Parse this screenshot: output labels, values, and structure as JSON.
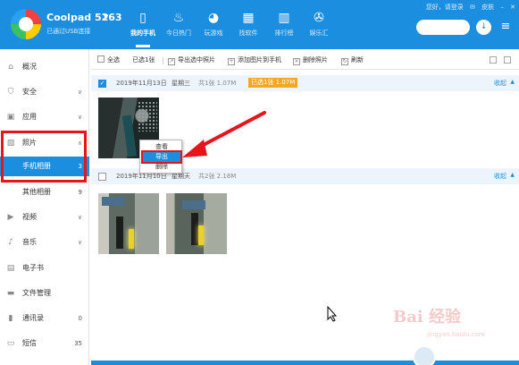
{
  "header": {
    "device_name": "Coolpad 5263",
    "device_status": "已通过USB连接",
    "nav_tabs": [
      {
        "label": "我的手机",
        "icon": "phone-icon",
        "active": true
      },
      {
        "label": "今日热门",
        "icon": "flame-icon",
        "active": false
      },
      {
        "label": "玩游戏",
        "icon": "gamepad-icon",
        "active": false
      },
      {
        "label": "找软件",
        "icon": "grid-icon",
        "active": false
      },
      {
        "label": "排行榜",
        "icon": "bar-chart-icon",
        "active": false
      },
      {
        "label": "娱乐汇",
        "icon": "film-reel-icon",
        "active": false
      }
    ],
    "top_links": {
      "greeting": "您好，请登录",
      "skin": "皮肤"
    },
    "accent_color": "#1c8ee0"
  },
  "sidebar": {
    "items": [
      {
        "label": "概况",
        "icon": "home-icon"
      },
      {
        "label": "安全",
        "icon": "shield-icon",
        "chevron": "∨"
      },
      {
        "label": "应用",
        "icon": "app-icon",
        "chevron": "∨"
      },
      {
        "label": "照片",
        "icon": "photo-icon",
        "chevron": "∧"
      },
      {
        "label": "手机相册",
        "count": "3",
        "active": true
      },
      {
        "label": "其他相册",
        "count": "9"
      },
      {
        "label": "视频",
        "icon": "video-icon",
        "chevron": "∨"
      },
      {
        "label": "音乐",
        "icon": "music-icon",
        "chevron": "∨"
      },
      {
        "label": "电子书",
        "icon": "book-icon"
      },
      {
        "label": "文件管理",
        "icon": "folder-icon"
      },
      {
        "label": "通讯录",
        "icon": "contacts-icon",
        "count": "0"
      },
      {
        "label": "短信",
        "icon": "sms-icon",
        "count": "35"
      }
    ]
  },
  "toolbar": {
    "select_all": "全选",
    "selected": "已选1张",
    "export": "导出选中照片",
    "add": "添加图片到手机",
    "delete": "删除照片",
    "refresh": "刷新"
  },
  "groups": [
    {
      "date": "2019年11月13日",
      "weekday": "星期三",
      "count": "共1张 1.07M",
      "badge": "已选1张 1.07M",
      "collapse": "收起",
      "checked": true
    },
    {
      "date": "2019年11月10日",
      "weekday": "星期天",
      "count": "共2张 2.18M",
      "collapse": "收起",
      "checked": false
    }
  ],
  "context_menu": {
    "items": [
      "查看",
      "导出",
      "删除"
    ],
    "highlighted": "导出"
  },
  "watermark": {
    "text": "Bai 经验",
    "sub": "jingyan.baidu.com"
  }
}
